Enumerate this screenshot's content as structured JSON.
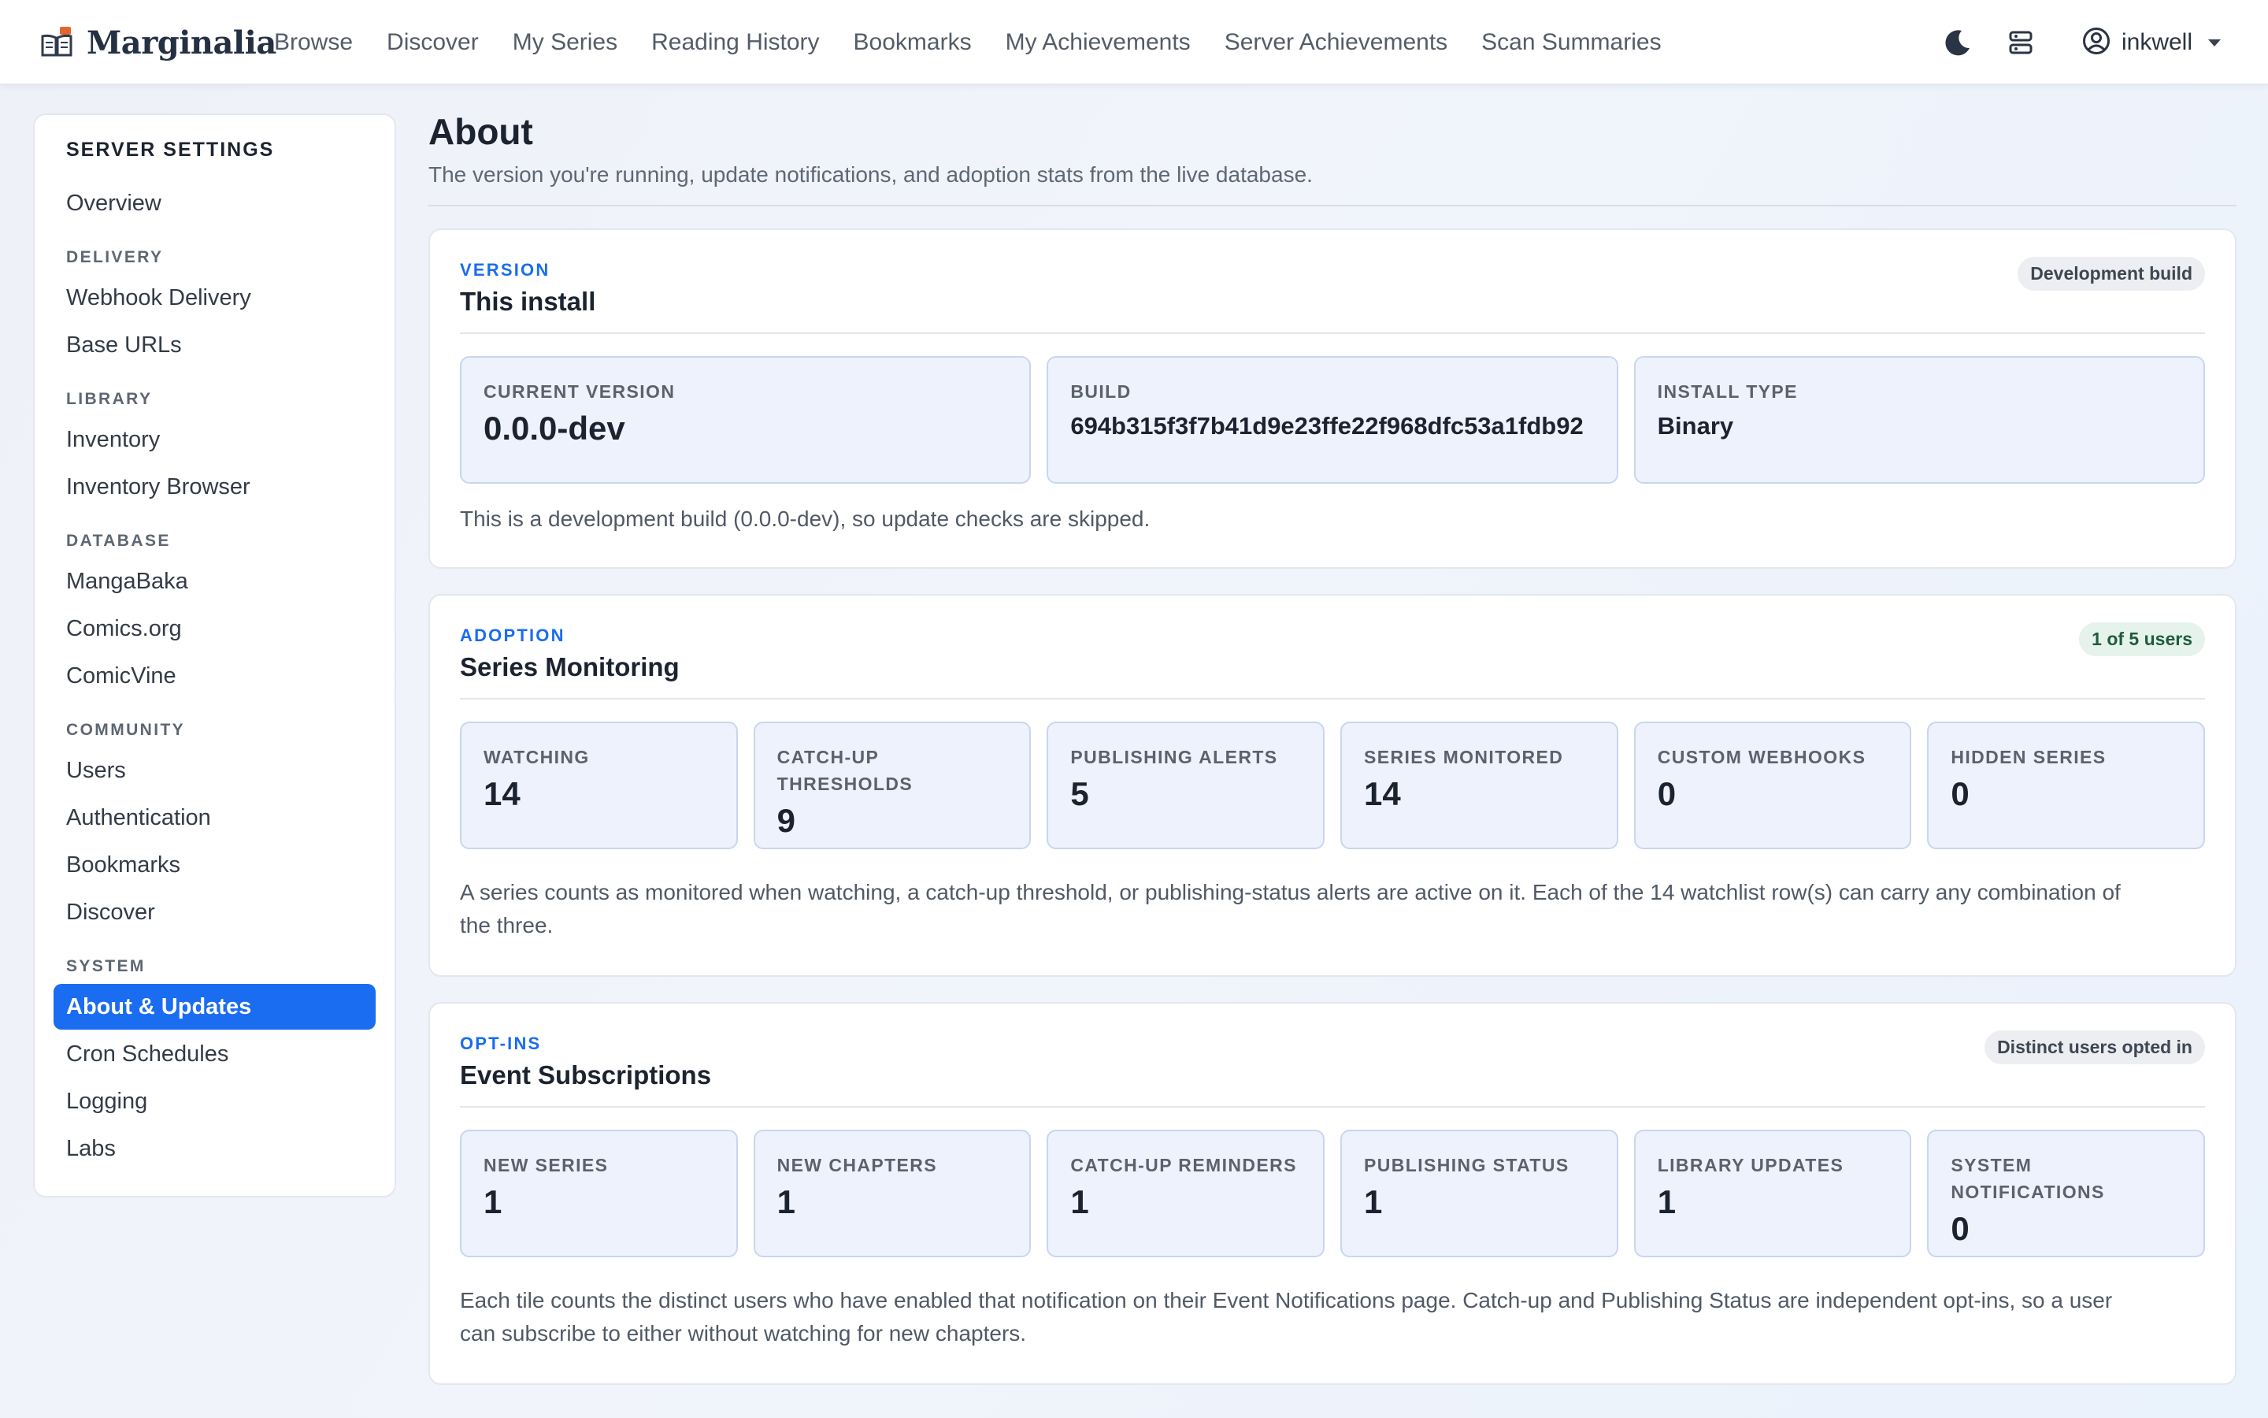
{
  "brand": {
    "name": "Marginalia",
    "logo_icon": "open-book-icon",
    "accent": "#e2662b"
  },
  "nav": {
    "links": [
      "Browse",
      "Discover",
      "My Series",
      "Reading History",
      "Bookmarks",
      "My Achievements",
      "Server Achievements",
      "Scan Summaries"
    ],
    "user": "inkwell",
    "icons": [
      "moon-icon",
      "server-icon",
      "user-circle-icon"
    ]
  },
  "sidebar": {
    "title": "SERVER SETTINGS",
    "overview": "Overview",
    "groups": [
      {
        "label": "DELIVERY",
        "items": [
          "Webhook Delivery",
          "Base URLs"
        ]
      },
      {
        "label": "LIBRARY",
        "items": [
          "Inventory",
          "Inventory Browser"
        ]
      },
      {
        "label": "DATABASE",
        "items": [
          "MangaBaka",
          "Comics.org",
          "ComicVine"
        ]
      },
      {
        "label": "COMMUNITY",
        "items": [
          "Users",
          "Authentication",
          "Bookmarks",
          "Discover"
        ]
      },
      {
        "label": "SYSTEM",
        "items": [
          "About & Updates",
          "Cron Schedules",
          "Logging",
          "Labs"
        ]
      }
    ],
    "active_item": "About & Updates"
  },
  "page": {
    "title": "About",
    "subtitle": "The version you're running, update notifications, and adoption stats from the live database."
  },
  "version_card": {
    "eyebrow": "VERSION",
    "title": "This install",
    "badge": "Development build",
    "tiles": [
      {
        "label": "CURRENT VERSION",
        "value": "0.0.0-dev"
      },
      {
        "label": "BUILD",
        "value": "694b315f3f7b41d9e23ffe22f968dfc53a1fdb92"
      },
      {
        "label": "INSTALL TYPE",
        "value": "Binary"
      }
    ],
    "note": "This is a development build (0.0.0-dev), so update checks are skipped."
  },
  "adoption_card": {
    "eyebrow": "ADOPTION",
    "title": "Series Monitoring",
    "badge": "1 of 5 users",
    "tiles": [
      {
        "label": "WATCHING",
        "value": "14"
      },
      {
        "label": "CATCH-UP THRESHOLDS",
        "value": "9"
      },
      {
        "label": "PUBLISHING ALERTS",
        "value": "5"
      },
      {
        "label": "SERIES MONITORED",
        "value": "14"
      },
      {
        "label": "CUSTOM WEBHOOKS",
        "value": "0"
      },
      {
        "label": "HIDDEN SERIES",
        "value": "0"
      }
    ],
    "note": "A series counts as monitored when watching, a catch-up threshold, or publishing-status alerts are active on it. Each of the 14 watchlist row(s) can carry any combination of the three."
  },
  "optins_card": {
    "eyebrow": "OPT-INS",
    "title": "Event Subscriptions",
    "badge": "Distinct users opted in",
    "tiles": [
      {
        "label": "NEW SERIES",
        "value": "1"
      },
      {
        "label": "NEW CHAPTERS",
        "value": "1"
      },
      {
        "label": "CATCH-UP REMINDERS",
        "value": "1"
      },
      {
        "label": "PUBLISHING STATUS",
        "value": "1"
      },
      {
        "label": "LIBRARY UPDATES",
        "value": "1"
      },
      {
        "label": "SYSTEM NOTIFICATIONS",
        "value": "0"
      }
    ],
    "note": "Each tile counts the distinct users who have enabled that notification on their Event Notifications page. Catch-up and Publishing Status are independent opt-ins, so a user can subscribe to either without watching for new chapters."
  },
  "colors": {
    "primary": "#1a6cf0",
    "tile_bg": "#edf2fd",
    "tile_border": "#c9d6ee"
  }
}
